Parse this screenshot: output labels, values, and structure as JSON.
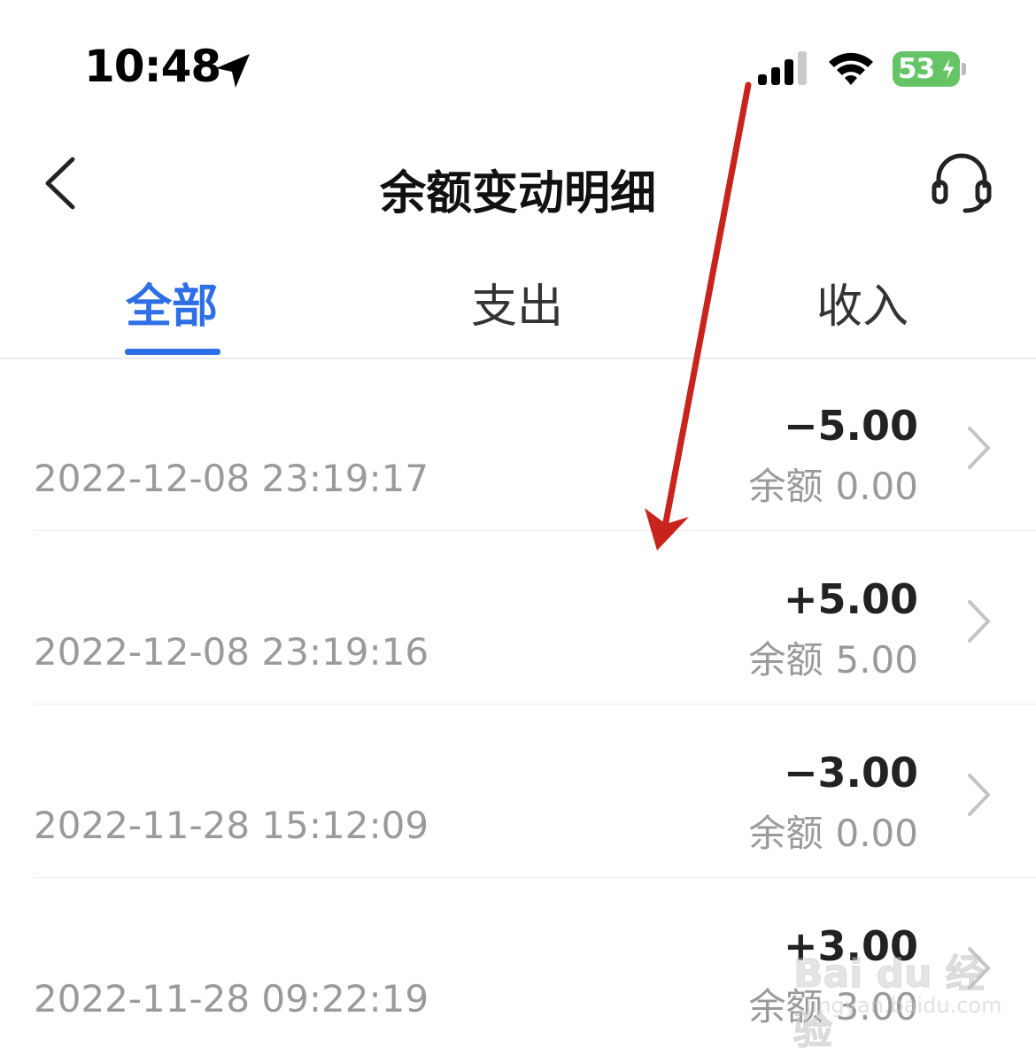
{
  "status_bar": {
    "time": "10:48",
    "battery_level": "53",
    "battery_charging": true,
    "signal_bars": 3,
    "icons": [
      "location-arrow-icon",
      "cellular-signal-icon",
      "wifi-icon",
      "battery-charging-icon"
    ]
  },
  "header": {
    "title": "余额变动明细",
    "back_icon": "chevron-left-icon",
    "service_icon": "headset-icon"
  },
  "tabs": [
    {
      "label": "全部",
      "active": true
    },
    {
      "label": "支出",
      "active": false
    },
    {
      "label": "收入",
      "active": false
    }
  ],
  "balance_label": "余额",
  "transactions": [
    {
      "datetime": "2022-12-08 23:19:17",
      "amount": "−5.00",
      "balance": "0.00"
    },
    {
      "datetime": "2022-12-08 23:19:16",
      "amount": "+5.00",
      "balance": "5.00"
    },
    {
      "datetime": "2022-11-28 15:12:09",
      "amount": "−3.00",
      "balance": "0.00"
    },
    {
      "datetime": "2022-11-28 09:22:19",
      "amount": "+3.00",
      "balance": "3.00"
    }
  ],
  "watermark": {
    "logo_text": "Bai du 经验",
    "url": "jingyan.baidu.com"
  },
  "colors": {
    "accent": "#2f6fe6",
    "annotation_arrow": "#c8231c",
    "battery": "#65c466"
  }
}
